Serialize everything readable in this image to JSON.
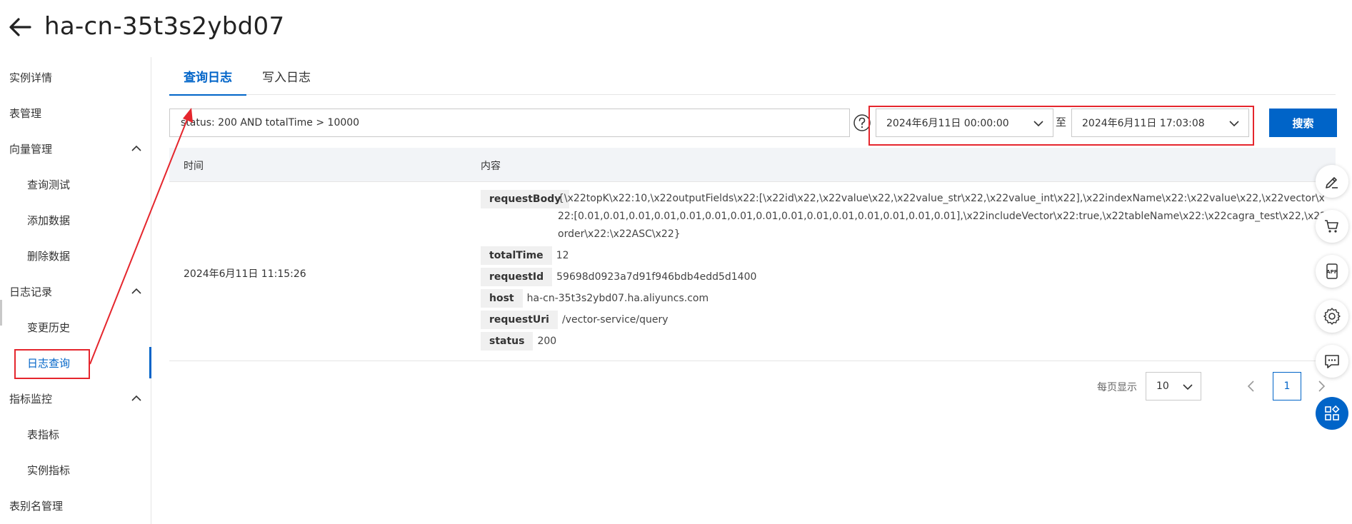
{
  "header": {
    "title": "ha-cn-35t3s2ybd07",
    "back_icon": "arrow-left-icon"
  },
  "sidebar": {
    "items": [
      {
        "label": "实例详情",
        "level": 1
      },
      {
        "label": "表管理",
        "level": 1
      },
      {
        "label": "向量管理",
        "level": 1,
        "expanded": true
      },
      {
        "label": "查询测试",
        "level": 2
      },
      {
        "label": "添加数据",
        "level": 2
      },
      {
        "label": "删除数据",
        "level": 2
      },
      {
        "label": "日志记录",
        "level": 1,
        "expanded": true
      },
      {
        "label": "变更历史",
        "level": 2
      },
      {
        "label": "日志查询",
        "level": 2,
        "active": true
      },
      {
        "label": "指标监控",
        "level": 1,
        "expanded": true
      },
      {
        "label": "表指标",
        "level": 2
      },
      {
        "label": "实例指标",
        "level": 2
      },
      {
        "label": "表别名管理",
        "level": 1
      }
    ]
  },
  "tabs": [
    {
      "label": "查询日志",
      "active": true
    },
    {
      "label": "写入日志",
      "active": false
    }
  ],
  "query": {
    "value": "status: 200 AND totalTime > 10000",
    "help_icon": "question-circle-icon"
  },
  "date_range": {
    "start": "2024年6月11日 00:00:00",
    "separator": "至",
    "end": "2024年6月11日 17:03:08"
  },
  "search_button": "搜索",
  "table": {
    "columns": [
      "时间",
      "内容"
    ],
    "rows": [
      {
        "time": "2024年6月11日 11:15:26",
        "fields": {
          "requestBody": {
            "key": "requestBody",
            "value": "{\\x22topK\\x22:10,\\x22outputFields\\x22:[\\x22id\\x22,\\x22value\\x22,\\x22value_str\\x22,\\x22value_int\\x22],\\x22indexName\\x22:\\x22value\\x22,\\x22vector\\x22:[0.01,0.01,0.01,0.01,0.01,0.01,0.01,0.01,0.01,0.01,0.01,0.01,0.01,0.01,0.01],\\x22includeVector\\x22:true,\\x22tableName\\x22:\\x22cagra_test\\x22,\\x22order\\x22:\\x22ASC\\x22}"
          },
          "totalTime": {
            "key": "totalTime",
            "value": "12"
          },
          "requestId": {
            "key": "requestId",
            "value": "59698d0923a7d91f946bdb4edd5d1400"
          },
          "host": {
            "key": "host",
            "value": "ha-cn-35t3s2ybd07.ha.aliyuncs.com"
          },
          "requestUri": {
            "key": "requestUri",
            "value": "/vector-service/query"
          },
          "status": {
            "key": "status",
            "value": "200"
          }
        }
      }
    ]
  },
  "pagination": {
    "page_size_label": "每页显示",
    "page_size": "10",
    "current_page": "1"
  },
  "floating_tools": [
    "edit-icon",
    "cart-icon",
    "app-icon",
    "settings-icon",
    "chat-icon",
    "grid-apps-icon"
  ],
  "colors": {
    "primary": "#0064c8",
    "annotation": "#e5262d",
    "header_bg": "#f2f4f7"
  }
}
